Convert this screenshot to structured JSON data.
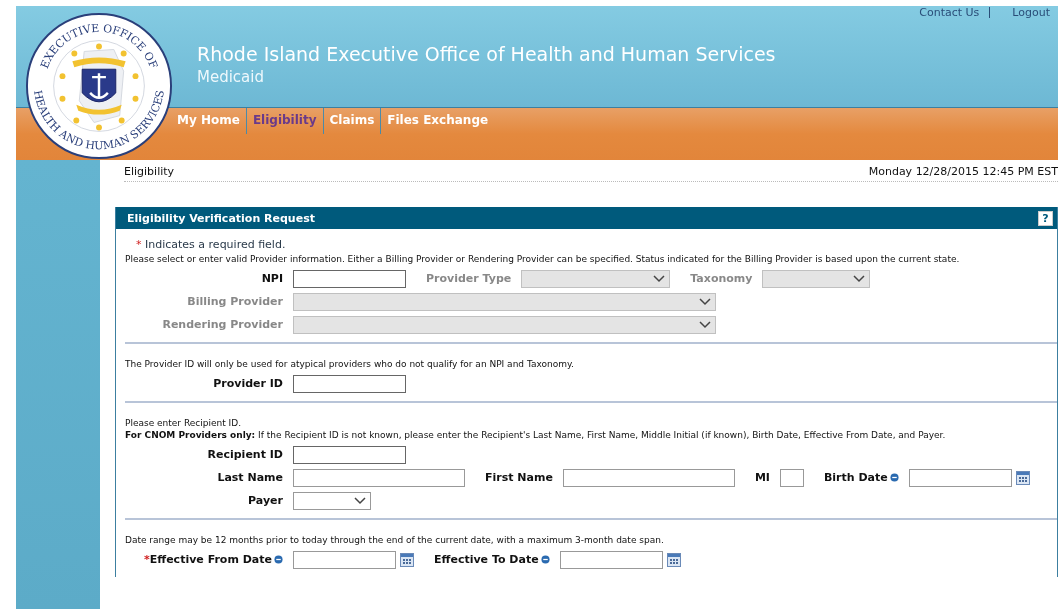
{
  "top_links": [
    {
      "label": "Contact Us"
    },
    {
      "label": "Logout"
    }
  ],
  "logo": {
    "ring_top": "EXECUTIVE OFFICE OF",
    "ring_bottom": "HEALTH AND HUMAN SERVICES"
  },
  "header": {
    "title": "Rhode Island Executive Office of Health and Human Services",
    "subtitle": "Medicaid"
  },
  "nav": [
    {
      "label": "My Home",
      "selected": false
    },
    {
      "label": "Eligibility",
      "selected": true
    },
    {
      "label": "Claims",
      "selected": false
    },
    {
      "label": "Files Exchange",
      "selected": false
    }
  ],
  "breadcrumb": "Eligibility",
  "datetime": "Monday 12/28/2015 12:45 PM EST",
  "panel": {
    "title": "Eligibility Verification Request",
    "help": "?",
    "required_note": "Indicates a required field.",
    "required_mark": "*",
    "sections": [
      {
        "notes": [
          "Please select or enter valid Provider information. Either a Billing Provider or Rendering Provider can be specified. Status indicated for the Billing Provider is based upon the current state."
        ],
        "rows": [
          [
            {
              "label": "NPI",
              "kind": "text",
              "disabled": false
            },
            {
              "label": "Provider Type",
              "kind": "select",
              "disabled": true
            },
            {
              "label": "Taxonomy",
              "kind": "short-select",
              "disabled": true
            }
          ],
          [
            {
              "label": "Billing Provider",
              "kind": "wide-select",
              "disabled": true
            }
          ],
          [
            {
              "label": "Rendering Provider",
              "kind": "wide-select",
              "disabled": true
            }
          ]
        ]
      },
      {
        "notes": [
          "The Provider ID will only be used for atypical providers who do not qualify for an NPI and Taxonomy."
        ],
        "rows": [
          [
            {
              "label": "Provider ID",
              "kind": "text",
              "disabled": false
            }
          ]
        ]
      },
      {
        "notes": [
          "Please enter Recipient ID.",
          "**For CNOM Providers only:** If the Recipient ID is not known, please enter the Recipient's Last Name, First Name, Middle Initial (if known), Birth Date, Effective From Date, and Payer."
        ],
        "rows": [
          [
            {
              "label": "Recipient ID",
              "kind": "text",
              "disabled": false
            }
          ],
          [
            {
              "label": "Last Name",
              "kind": "name",
              "disabled": false
            },
            {
              "label": "First Name",
              "kind": "name",
              "disabled": false
            },
            {
              "label": "MI",
              "kind": "initial",
              "disabled": false
            },
            {
              "label": "Birth Date",
              "kind": "date",
              "disabled": false,
              "info": true
            }
          ],
          [
            {
              "label": "Payer",
              "kind": "tiny-select",
              "disabled": false
            }
          ]
        ]
      },
      {
        "notes": [
          "Date range may be 12 months prior to today through the end of the current date, with a maximum 3-month date span."
        ],
        "rows": [
          [
            {
              "label": "Effective From Date",
              "kind": "date",
              "disabled": false,
              "info": true,
              "required": true
            },
            {
              "label": "Effective To Date",
              "kind": "date",
              "disabled": false,
              "info": true
            }
          ]
        ]
      }
    ]
  }
}
